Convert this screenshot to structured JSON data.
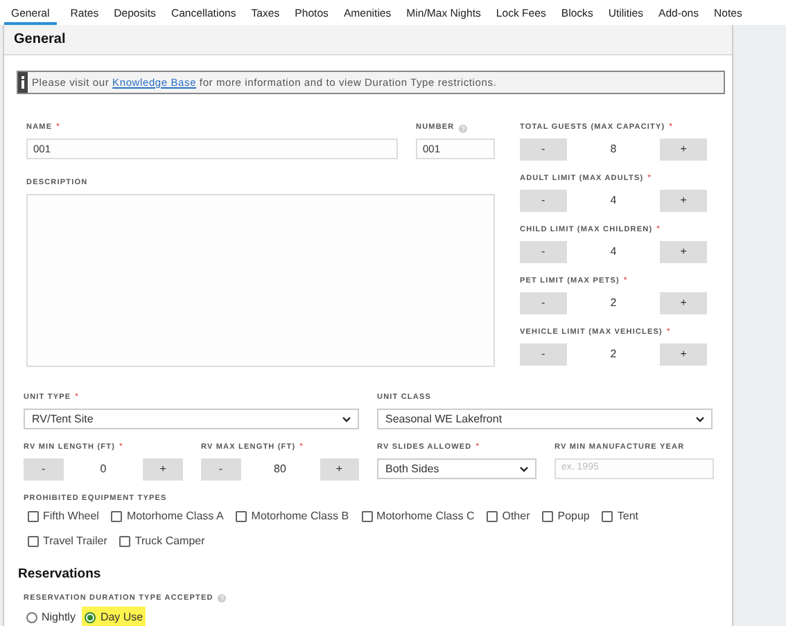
{
  "tabs": [
    {
      "label": "General",
      "selected": true
    },
    {
      "label": "Rates",
      "selected": false
    },
    {
      "label": "Deposits",
      "selected": false
    },
    {
      "label": "Cancellations",
      "selected": false
    },
    {
      "label": "Taxes",
      "selected": false
    },
    {
      "label": "Photos",
      "selected": false
    },
    {
      "label": "Amenities",
      "selected": false
    },
    {
      "label": "Min/Max Nights",
      "selected": false
    },
    {
      "label": "Lock Fees",
      "selected": false
    },
    {
      "label": "Blocks",
      "selected": false
    },
    {
      "label": "Utilities",
      "selected": false
    },
    {
      "label": "Add-ons",
      "selected": false
    },
    {
      "label": "Notes",
      "selected": false
    }
  ],
  "panel": {
    "title": "General",
    "notice": {
      "before": "Please visit our",
      "link": "Knowledge Base",
      "after": "for more information and to view Duration Type restrictions."
    },
    "name": {
      "label": "NAME",
      "required_mark": "*",
      "value": "001"
    },
    "number": {
      "label": "NUMBER",
      "help": true,
      "value": "001"
    },
    "description": {
      "label": "DESCRIPTION"
    },
    "limits": [
      {
        "label": "TOTAL GUESTS (MAX CAPACITY)",
        "required_mark": "*",
        "minus": "-",
        "value": "8",
        "plus": "+"
      },
      {
        "label": "ADULT LIMIT (MAX ADULTS)",
        "required_mark": "*",
        "minus": "-",
        "value": "4",
        "plus": "+"
      },
      {
        "label": "CHILD LIMIT (MAX CHILDREN)",
        "required_mark": "*",
        "minus": "-",
        "value": "4",
        "plus": "+"
      },
      {
        "label": "PET LIMIT (MAX PETS)",
        "required_mark": "*",
        "minus": "-",
        "value": "2",
        "plus": "+"
      },
      {
        "label": "VEHICLE LIMIT (MAX VEHICLES)",
        "required_mark": "*",
        "minus": "-",
        "value": "2",
        "plus": "+"
      }
    ],
    "unit_type": {
      "label": "UNIT TYPE",
      "required_mark": "*",
      "value": "RV/Tent Site"
    },
    "unit_class": {
      "label": "UNIT CLASS",
      "value": "Seasonal WE Lakefront"
    },
    "rv_min_length": {
      "label": "RV MIN LENGTH (FT)",
      "required_mark": "*",
      "minus": "-",
      "value": "0",
      "plus": "+"
    },
    "rv_max_length": {
      "label": "RV MAX LENGTH (FT)",
      "required_mark": "*",
      "minus": "-",
      "value": "80",
      "plus": "+"
    },
    "rv_slides": {
      "label": "RV SLIDES ALLOWED",
      "required_mark": "*",
      "value": "Both Sides"
    },
    "rv_year": {
      "label": "RV MIN MANUFACTURE YEAR",
      "placeholder": "ex. 1995"
    },
    "prohibited": {
      "label": "PROHIBITED EQUIPMENT TYPES",
      "options": [
        {
          "label": "Fifth Wheel",
          "checked": false
        },
        {
          "label": "Motorhome Class A",
          "checked": false
        },
        {
          "label": "Motorhome Class B",
          "checked": false
        },
        {
          "label": "Motorhome Class C",
          "checked": false
        },
        {
          "label": "Other",
          "checked": false
        },
        {
          "label": "Popup",
          "checked": false
        },
        {
          "label": "Tent",
          "checked": false
        },
        {
          "label": "Travel Trailer",
          "checked": false
        },
        {
          "label": "Truck Camper",
          "checked": false
        }
      ]
    },
    "reservations": {
      "title": "Reservations",
      "duration_label": "RESERVATION DURATION TYPE ACCEPTED",
      "help": true,
      "options": [
        {
          "label": "Nightly",
          "selected": false
        },
        {
          "label": "Day Use",
          "selected": true
        }
      ]
    }
  }
}
